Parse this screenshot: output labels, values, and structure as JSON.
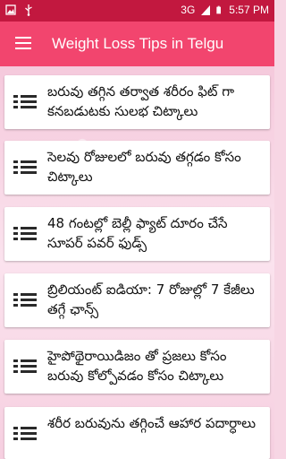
{
  "status_bar": {
    "network": "3G",
    "time": "5:57 PM"
  },
  "app_bar": {
    "title": "Weight Loss Tips in Telgu"
  },
  "list": {
    "items": [
      {
        "title": "బరువు తగ్గిన తర్వాత శరీరం ఫిట్ గా కనబడుటకు సులభ చిట్కాలు"
      },
      {
        "title": "సెలవు రోజులలో బరువు తగ్గడం కోసం చిట్కాలు"
      },
      {
        "title": "48 గంటల్లో బెల్లీ ఫ్యాట్ దూరం చేసే సూపర్ పవర్ ఫుడ్స్"
      },
      {
        "title": "బ్రిలియంట్ ఐడియా: 7 రోజుల్లో 7 కేజీలు తగ్గే ఛాన్స్"
      },
      {
        "title": "హైపోథైరాయిడిజం తో ప్రజలు కోసం బరువు కోల్పోవడం కోసం చిట్కాలు"
      },
      {
        "title": "శరీర బరువును తగ్గించే ఆహార పదార్ధాలు"
      }
    ]
  },
  "colors": {
    "status_bar": "#c2183f",
    "app_bar": "#f2456e",
    "background": "#f7d6e4"
  }
}
